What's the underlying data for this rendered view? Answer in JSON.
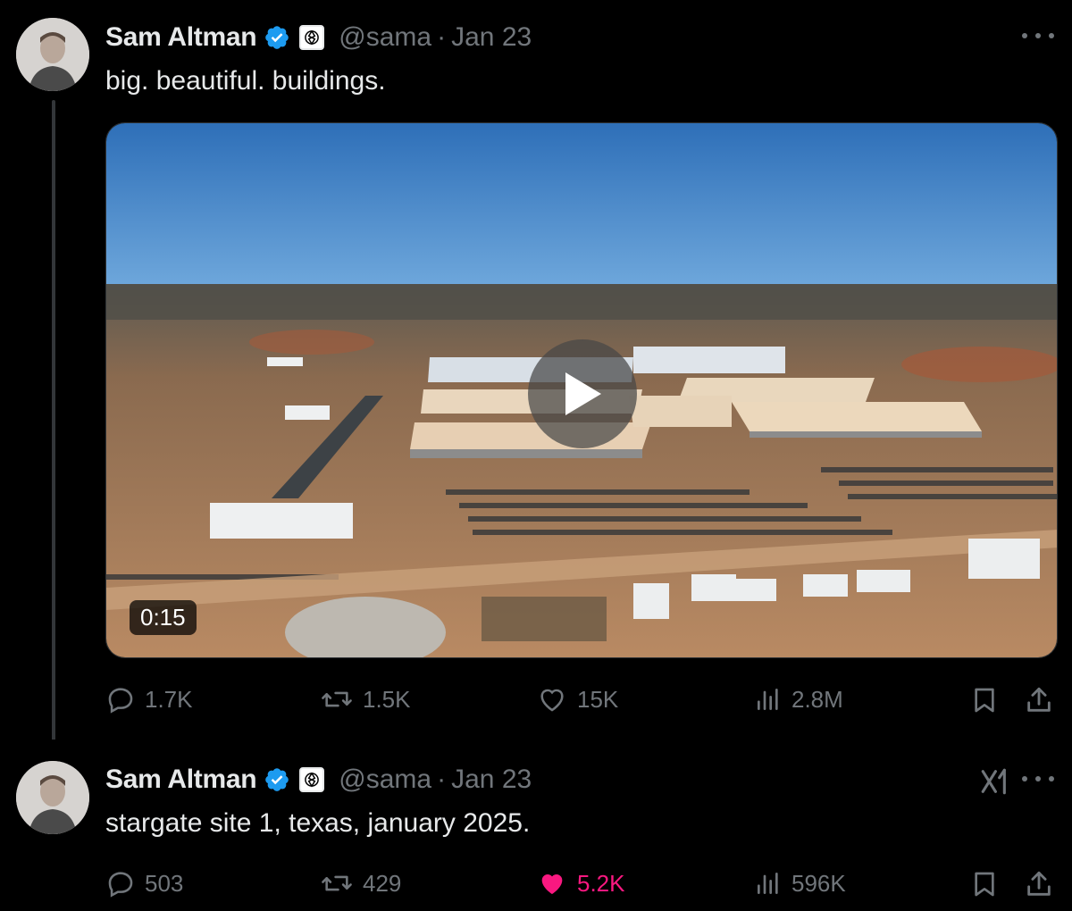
{
  "colors": {
    "background": "#000000",
    "text_primary": "#e7e9ea",
    "text_secondary": "#71767b",
    "verified_blue": "#1d9bf0",
    "like_pink": "#f91880"
  },
  "tweets": [
    {
      "author": {
        "name": "Sam Altman",
        "handle": "@sama",
        "separator": "·",
        "date": "Jan 23"
      },
      "text": "big. beautiful. buildings.",
      "media": {
        "type": "video",
        "duration": "0:15"
      },
      "actions": {
        "replies": "1.7K",
        "reposts": "1.5K",
        "likes": "15K",
        "views": "2.8M"
      },
      "liked": false,
      "icons": [
        "verified-badge-icon",
        "openai-logo-icon",
        "more-icon",
        "reply-icon",
        "repost-icon",
        "like-icon",
        "views-icon",
        "bookmark-icon",
        "share-icon"
      ]
    },
    {
      "author": {
        "name": "Sam Altman",
        "handle": "@sama",
        "separator": "·",
        "date": "Jan 23"
      },
      "text": "stargate site 1, texas, january 2025.",
      "actions": {
        "replies": "503",
        "reposts": "429",
        "likes": "5.2K",
        "views": "596K"
      },
      "liked": true,
      "icons": [
        "verified-badge-icon",
        "openai-logo-icon",
        "grok-icon",
        "more-icon",
        "reply-icon",
        "repost-icon",
        "like-filled-icon",
        "views-icon",
        "bookmark-icon",
        "share-icon"
      ]
    }
  ]
}
